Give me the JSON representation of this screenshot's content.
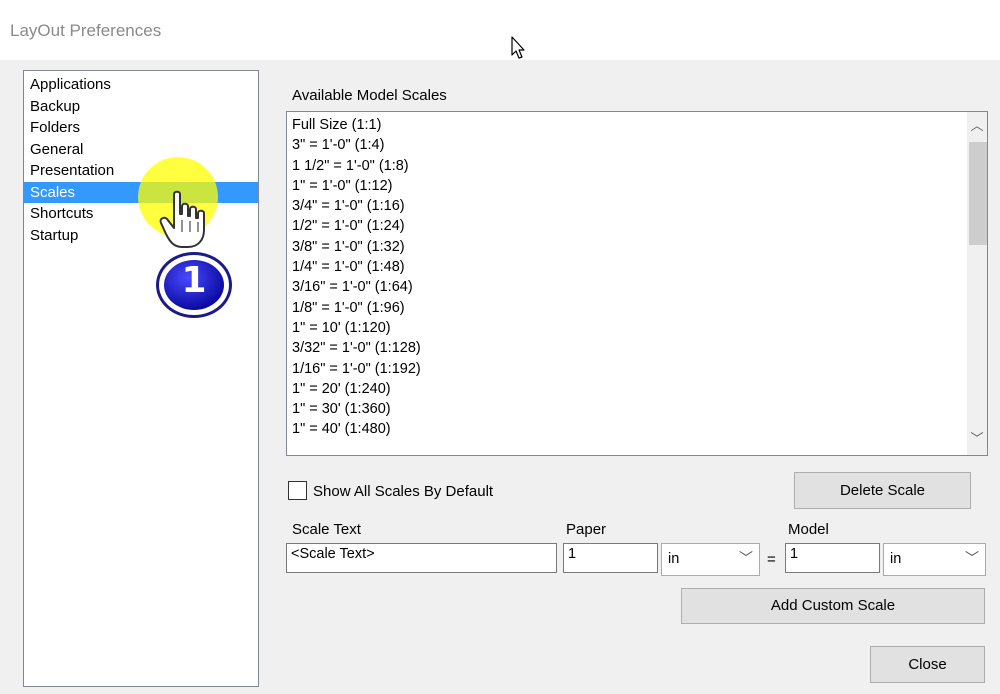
{
  "window": {
    "title": "LayOut Preferences"
  },
  "categories": [
    {
      "label": "Applications",
      "selected": false
    },
    {
      "label": "Backup",
      "selected": false
    },
    {
      "label": "Folders",
      "selected": false
    },
    {
      "label": "General",
      "selected": false
    },
    {
      "label": "Presentation",
      "selected": false
    },
    {
      "label": "Scales",
      "selected": true
    },
    {
      "label": "Shortcuts",
      "selected": false
    },
    {
      "label": "Startup",
      "selected": false
    }
  ],
  "scales": {
    "heading": "Available Model Scales",
    "items": [
      "Full Size (1:1)",
      "3\" = 1'-0\" (1:4)",
      "1 1/2\" = 1'-0\" (1:8)",
      "1\" = 1'-0\" (1:12)",
      "3/4\" = 1'-0\" (1:16)",
      "1/2\" = 1'-0\" (1:24)",
      "3/8\" = 1'-0\" (1:32)",
      "1/4\" = 1'-0\" (1:48)",
      "3/16\" = 1'-0\" (1:64)",
      "1/8\" = 1'-0\" (1:96)",
      "1\" = 10' (1:120)",
      "3/32\" = 1'-0\" (1:128)",
      "1/16\" = 1'-0\" (1:192)",
      "1\" = 20' (1:240)",
      "1\" = 30' (1:360)",
      "1\" = 40' (1:480)"
    ],
    "show_all_label": "Show All Scales By Default",
    "show_all_checked": false,
    "delete_button": "Delete Scale",
    "scale_text_label": "Scale Text",
    "scale_text_value": "<Scale Text>",
    "paper_label": "Paper",
    "paper_value": "1",
    "paper_unit": "in",
    "equals": "=",
    "model_label": "Model",
    "model_value": "1",
    "model_unit": "in",
    "add_button": "Add Custom Scale",
    "close_button": "Close"
  },
  "annotation": {
    "step_number": "1",
    "highlight_color": "#ffff00",
    "badge_color": "#1414c8"
  },
  "colors": {
    "selection": "#3399ff",
    "dialog_bg": "#f0f0f0"
  }
}
